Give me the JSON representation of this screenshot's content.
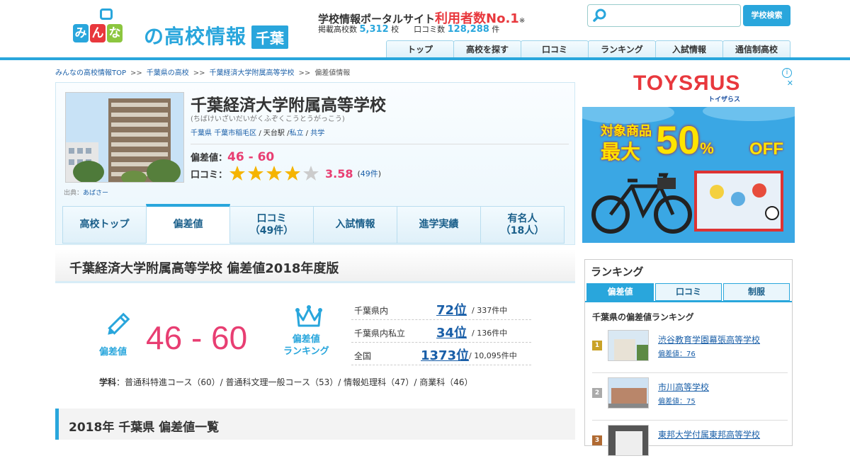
{
  "header": {
    "logo_prefix": "みんな",
    "logo_main": "の高校情報",
    "logo_pref": "千葉",
    "tagline_prefix": "学校情報ポータルサイト",
    "tagline_highlight": "利用者数No.1",
    "tagline_note": "※",
    "stats_schools_label": "掲載高校数",
    "stats_schools_value": "5,312",
    "stats_schools_unit": "校",
    "stats_reviews_label": "口コミ数",
    "stats_reviews_value": "128,288",
    "stats_reviews_unit": "件",
    "search_placeholder": "",
    "search_button": "学校検索",
    "nav": [
      "トップ",
      "高校を探す",
      "口コミ",
      "ランキング",
      "入試情報",
      "通信制高校"
    ]
  },
  "breadcrumb": [
    "みんなの高校情報TOP",
    "千葉県の高校",
    "千葉経済大学附属高等学校",
    "偏差値情報"
  ],
  "breadcrumb_sep": ">>",
  "school": {
    "name": "千葉経済大学附属高等学校",
    "kana": "(ちばけいざいだいがくふぞくこうとうがっこう)",
    "pref": "千葉県",
    "city": "千葉市稲毛区",
    "station": "天台駅",
    "type": "私立",
    "gender": "共学",
    "credit_label": "出典：",
    "credit_name": "あばさー",
    "hensachi_label": "偏差値：",
    "hensachi": "46 - 60",
    "kuchikomi_label": "口コミ：",
    "rating": "3.58",
    "rating_stars": 3.58,
    "review_count": "49件"
  },
  "tabs": [
    {
      "label": "高校トップ",
      "sub": ""
    },
    {
      "label": "偏差値",
      "sub": ""
    },
    {
      "label": "口コミ",
      "sub": "（49件）"
    },
    {
      "label": "入試情報",
      "sub": ""
    },
    {
      "label": "進学実績",
      "sub": ""
    },
    {
      "label": "有名人",
      "sub": "（18人）"
    }
  ],
  "main": {
    "title": "千葉経済大学附属高等学校 偏差値2018年度版",
    "hensachi_icon_label": "偏差値",
    "hensachi_value": "46 - 60",
    "ranking_icon_label_1": "偏差値",
    "ranking_icon_label_2": "ランキング",
    "rankings": [
      {
        "label": "千葉県内",
        "rank": "72位",
        "total": "/ 337件中"
      },
      {
        "label": "千葉県内私立",
        "rank": "34位",
        "total": "/ 136件中"
      },
      {
        "label": "全国",
        "rank": "1373位",
        "total": "/ 10,095件中"
      }
    ],
    "courses_label": "学科",
    "courses_text": "：普通科特進コース（60）/ 普通科文理一般コース（53）/ 情報処理科（47）/ 商業科（46）",
    "list_title": "2018年 千葉県 偏差値一覧"
  },
  "ad": {
    "brand": "TOYSЯUS",
    "brand_sub": "トイザらス",
    "line1": "対象商品",
    "line2": "最大",
    "pct": "50",
    "pct_sign": "%",
    "off": "OFF",
    "info": "i",
    "close": "✕",
    "colors": {
      "bg": "#3aa7e4",
      "text": "#ffe400",
      "brand": "#e8383d"
    }
  },
  "sidebar": {
    "title": "ランキング",
    "tabs": [
      "偏差値",
      "口コミ",
      "制服"
    ],
    "subtitle": "千葉県の偏差値ランキング",
    "items": [
      {
        "rank": "1",
        "name": "渋谷教育学園幕張高等学校",
        "hensachi": "偏差値：76"
      },
      {
        "rank": "2",
        "name": "市川高等学校",
        "hensachi": "偏差値：75"
      },
      {
        "rank": "3",
        "name": "東邦大学付属東邦高等学校",
        "hensachi": ""
      }
    ]
  },
  "colors": {
    "accent": "#29a6dc",
    "highlight": "#e83e72",
    "link": "#1a5fa8"
  }
}
